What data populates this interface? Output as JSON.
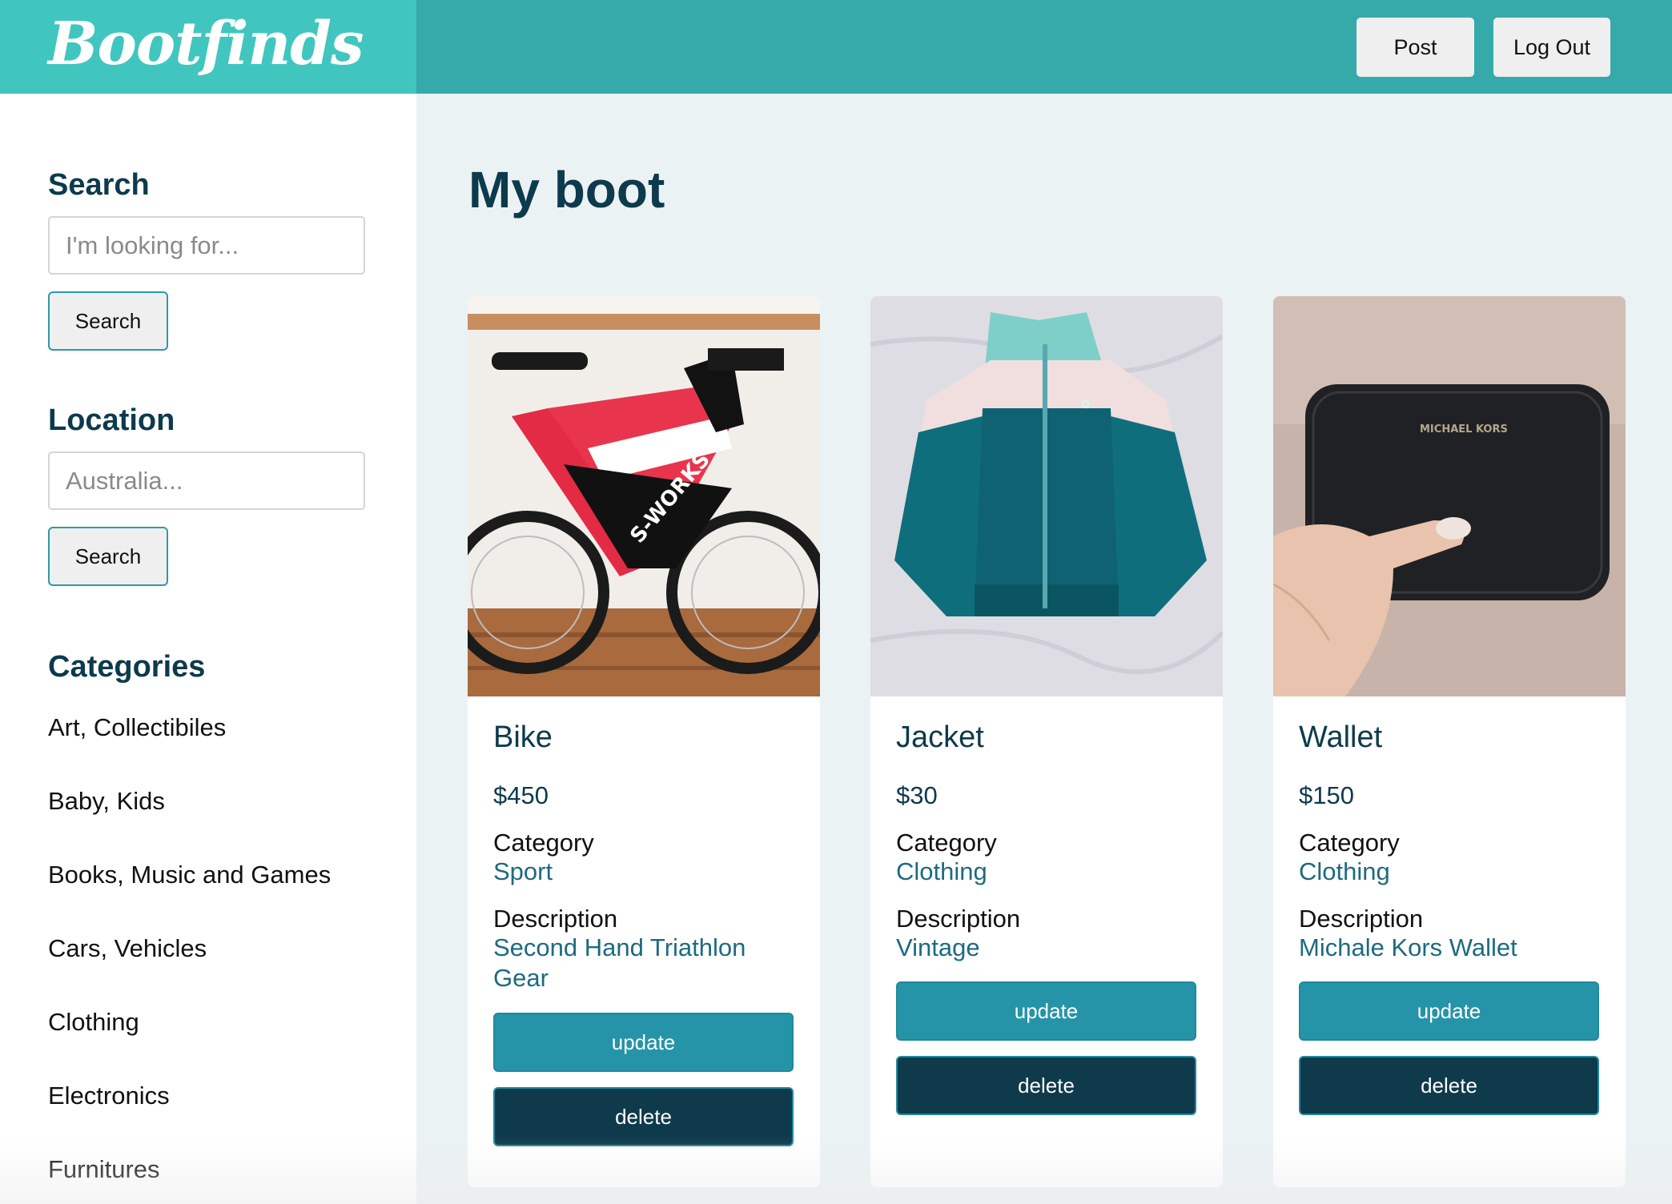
{
  "header": {
    "logo": "Bootfinds",
    "post_label": "Post",
    "logout_label": "Log Out"
  },
  "sidebar": {
    "search": {
      "heading": "Search",
      "placeholder": "I'm looking for...",
      "button_label": "Search"
    },
    "location": {
      "heading": "Location",
      "placeholder": "Australia...",
      "button_label": "Search"
    },
    "categories": {
      "heading": "Categories",
      "items": [
        "Art, Collectibiles",
        "Baby, Kids",
        "Books, Music and Games",
        "Cars, Vehicles",
        "Clothing",
        "Electronics",
        "Furnitures"
      ]
    }
  },
  "main": {
    "title": "My boot",
    "category_label": "Category",
    "description_label": "Description",
    "update_label": "update",
    "delete_label": "delete",
    "items": [
      {
        "title": "Bike",
        "price": "$450",
        "category": "Sport",
        "description": "Second Hand Triathlon Gear",
        "image": "bike-photo"
      },
      {
        "title": "Jacket",
        "price": "$30",
        "category": "Clothing",
        "description": "Vintage",
        "image": "jacket-photo"
      },
      {
        "title": "Wallet",
        "price": "$150",
        "category": "Clothing",
        "description": "Michale Kors Wallet",
        "image": "wallet-photo"
      }
    ]
  },
  "colors": {
    "header_bg": "#36a9aa",
    "logo_bg": "#40c6bf",
    "dark_teal": "#0d3a4c",
    "update_btn": "#2594a8",
    "delete_btn": "#0e3a4b",
    "page_bg": "#ebf2f4"
  }
}
